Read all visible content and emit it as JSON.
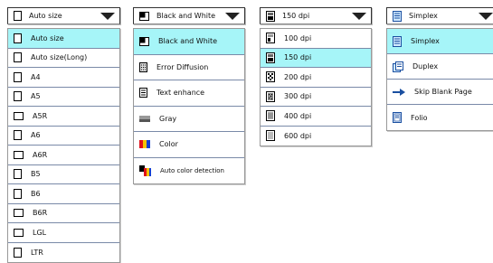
{
  "paper_size": {
    "selected": "Auto size",
    "options": [
      "Auto size",
      "Auto size(Long)",
      "A4",
      "A5",
      "A5R",
      "A6",
      "A6R",
      "B5",
      "B6",
      "B6R",
      "LGL",
      "LTR"
    ],
    "icons": [
      "page-portrait-icon",
      "page-portrait-icon",
      "page-portrait-icon",
      "page-portrait-icon",
      "page-landscape-icon",
      "page-portrait-icon",
      "page-landscape-icon",
      "page-portrait-icon",
      "page-portrait-icon",
      "page-landscape-icon",
      "page-landscape-icon",
      "page-portrait-icon"
    ]
  },
  "color_mode": {
    "selected": "Black and White",
    "options": [
      "Black and White",
      "Error Diffusion",
      "Text enhance",
      "Gray",
      "Color",
      "Auto color detection"
    ],
    "icons": [
      "black-white-icon",
      "error-diffusion-icon",
      "text-enhance-icon",
      "gray-icon",
      "color-icon",
      "auto-color-icon"
    ]
  },
  "resolution": {
    "selected": "150 dpi",
    "options": [
      "100 dpi",
      "150 dpi",
      "200 dpi",
      "300 dpi",
      "400 dpi",
      "600 dpi"
    ],
    "icons": [
      "dpi-100-icon",
      "dpi-150-icon",
      "dpi-200-icon",
      "dpi-300-icon",
      "dpi-400-icon",
      "dpi-600-icon"
    ]
  },
  "scan_side": {
    "selected": "Simplex",
    "options": [
      "Simplex",
      "Duplex",
      "Skip Blank Page",
      "Folio"
    ],
    "icons": [
      "simplex-icon",
      "duplex-icon",
      "skip-blank-page-icon",
      "folio-icon"
    ]
  },
  "colors": {
    "selected_bg": "#a6f5f8",
    "separator": "#7a8aa8"
  }
}
